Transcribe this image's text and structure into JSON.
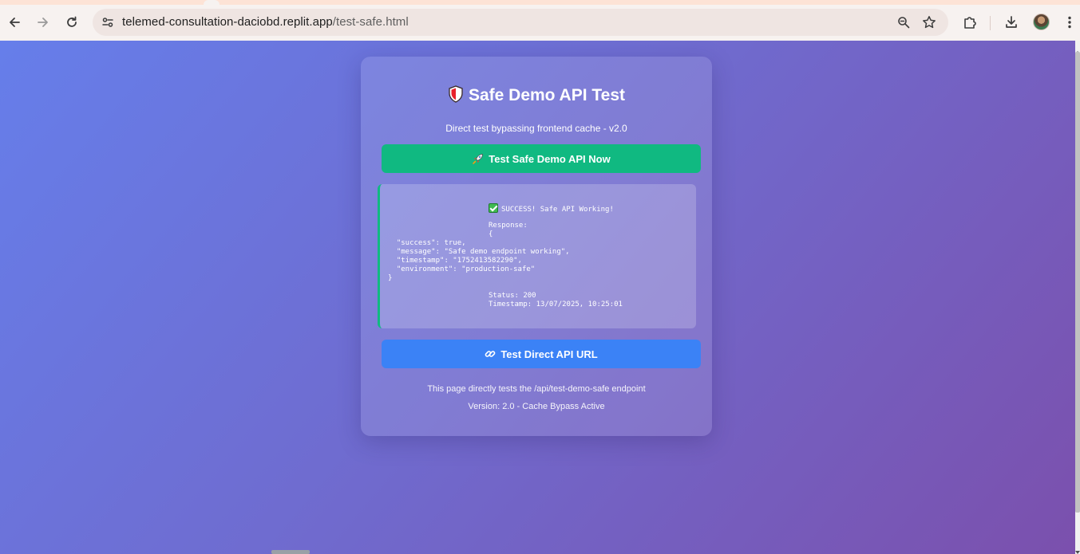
{
  "browser": {
    "url_host": "telemed-consultation-daciobd.replit.app",
    "url_path": "/test-safe.html",
    "icons": [
      "back-icon",
      "forward-icon",
      "reload-icon",
      "site-settings-icon",
      "zoom-icon",
      "bookmark-star-icon",
      "extensions-icon",
      "download-icon",
      "profile-avatar",
      "more-menu-icon"
    ]
  },
  "card": {
    "title": "Safe Demo API Test",
    "subtitle": "Direct test bypassing frontend cache - v2.0",
    "test_button_label": "Test Safe Demo API Now",
    "direct_button_label": "Test Direct API URL",
    "footer_note": "This page directly tests the /api/test-demo-safe endpoint",
    "version_note": "Version: 2.0 - Cache Bypass Active"
  },
  "result": {
    "success_text": "SUCCESS! Safe API Working!",
    "response_label": "Response:",
    "json_open": "{",
    "json_success": "  \"success\": true,",
    "json_message": "  \"message\": \"Safe demo endpoint working\",",
    "json_timestamp": "  \"timestamp\": \"1752413582290\",",
    "json_environment": "  \"environment\": \"production-safe\"",
    "json_close": "}",
    "status": "Status: 200",
    "timestamp": "Timestamp: 13/07/2025, 10:25:01"
  },
  "colors": {
    "accent_green": "#10b981",
    "accent_blue": "#3b82f6",
    "background_start": "#667eea",
    "background_end": "#7b50ad"
  }
}
